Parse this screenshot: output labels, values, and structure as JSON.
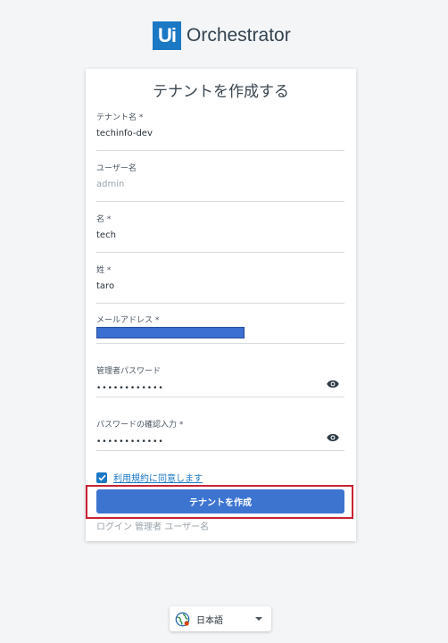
{
  "brand": {
    "logo_mark": "Ui",
    "name": "Orchestrator"
  },
  "form": {
    "title": "テナントを作成する",
    "fields": [
      {
        "label": "テナント名 *",
        "value": "techinfo-dev"
      },
      {
        "label": "ユーザー名",
        "value": "admin"
      },
      {
        "label": "名 *",
        "value": "tech"
      },
      {
        "label": "姓 *",
        "value": "taro"
      },
      {
        "label": "メールアドレス *",
        "value": ""
      },
      {
        "label": "管理者パスワード",
        "value": "••••••••••••"
      },
      {
        "label": "パスワードの確認入力 *",
        "value": "••••••••••••"
      }
    ],
    "terms_label": "利用規約に同意します",
    "submit_label": "テナントを作成",
    "hint": "ログイン 管理者 ユーザー名"
  },
  "language": {
    "selected": "日本語"
  },
  "colors": {
    "brand": "#1b78c4",
    "button": "#3d74d0",
    "highlight": "#c82333",
    "redaction": "#3b6fd1"
  },
  "icons": [
    "eye-icon",
    "globe-icon",
    "chevron-down-icon",
    "check-icon"
  ]
}
